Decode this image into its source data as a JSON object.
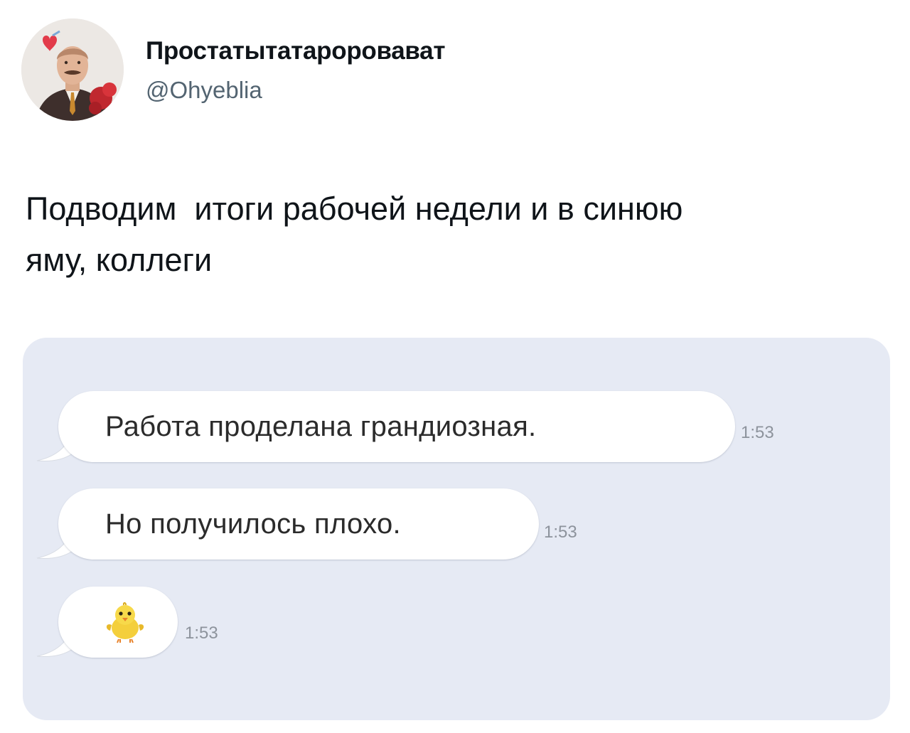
{
  "tweet": {
    "author": {
      "display_name": "Простатытатароровават",
      "handle": "@Ohyeblia",
      "avatar": "profile-photo"
    },
    "text": "Подводим  итоги рабочей недели и в синюю\nяму, коллеги"
  },
  "media": {
    "background_color": "#e6eaf4",
    "messages": [
      {
        "text": "Работа проделана грандиозная.",
        "time": "1:53"
      },
      {
        "text": "Но получилось плохо.",
        "time": "1:53"
      },
      {
        "icon": "chick-emoji-icon",
        "time": "1:53"
      }
    ]
  },
  "colors": {
    "name": "#0f1419",
    "handle": "#536471",
    "bubble": "#ffffff",
    "timestamp": "#8d939c"
  }
}
